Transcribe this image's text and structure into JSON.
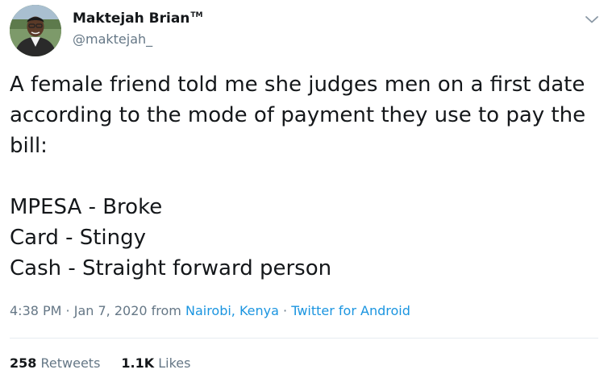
{
  "author": {
    "name": "Maktejah Brian",
    "tm": "TM",
    "handle": "@maktejah_"
  },
  "tweet": {
    "text": "A female friend told me she judges men on a first date\naccording to the mode of payment they use to pay the\nbill:\n\nMPESA - Broke\nCard - Stingy\nCash - Straight forward person",
    "time": "4:38 PM",
    "sep1": " · ",
    "date": "Jan 7, 2020",
    "from_text": " from ",
    "location": "Nairobi, Kenya",
    "sep2": " · ",
    "source": "Twitter for Android"
  },
  "stats": {
    "retweets_count": "258",
    "retweets_label": "Retweets",
    "likes_count": "1.1K",
    "likes_label": "Likes"
  },
  "icons": {
    "menu": "chevron-down-icon",
    "avatar": "profile-photo"
  },
  "colors": {
    "text": "#14171a",
    "secondary": "#657786",
    "link": "#1b95e0",
    "divider": "#e6ecf0"
  }
}
